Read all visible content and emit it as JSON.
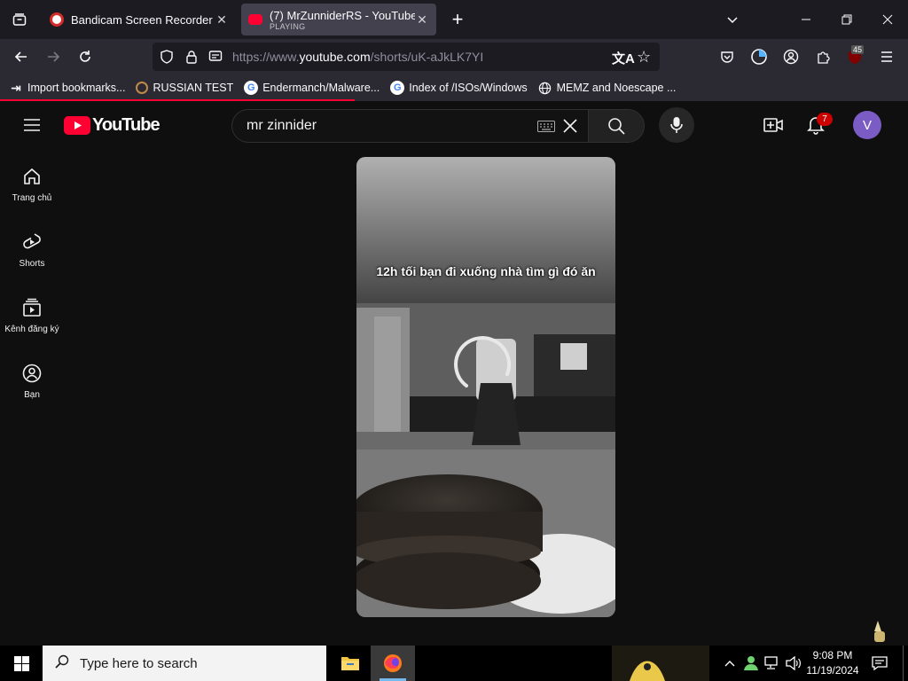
{
  "browser": {
    "tabs": [
      {
        "title": "Bandicam Screen Recorder Dow",
        "favicon": "bandicam-icon"
      },
      {
        "title": "(7) MrZunniderRS - YouTube",
        "status": "PLAYING",
        "favicon": "youtube-icon"
      }
    ],
    "url_prefix": "https://www.",
    "url_host": "youtube.com",
    "url_path": "/shorts/uK-aJkLK7YI",
    "extension_badge": "45",
    "bookmarks": [
      {
        "label": "Import bookmarks...",
        "icon": "import-icon"
      },
      {
        "label": "RUSSIAN TEST",
        "icon": "site-icon"
      },
      {
        "label": "Endermanch/Malware...",
        "icon": "google-icon"
      },
      {
        "label": "Index of /ISOs/Windows",
        "icon": "google-icon"
      },
      {
        "label": "MEMZ and Noescape ...",
        "icon": "globe-icon"
      }
    ]
  },
  "youtube": {
    "logo_text": "YouTube",
    "search_value": "mr zinnider",
    "notification_count": "7",
    "avatar_letter": "V",
    "sidebar": [
      {
        "label": "Trang chủ",
        "icon": "home-icon"
      },
      {
        "label": "Shorts",
        "icon": "shorts-icon"
      },
      {
        "label": "Kênh đăng ký",
        "icon": "subscriptions-icon"
      },
      {
        "label": "Bạn",
        "icon": "you-icon"
      }
    ],
    "video_caption": "12h tối bạn đi xuống nhà tìm gì đó ăn"
  },
  "taskbar": {
    "search_placeholder": "Type here to search",
    "time": "9:08 PM",
    "date": "11/19/2024"
  },
  "colors": {
    "youtube_red": "#ff0033",
    "avatar_purple": "#7b5cc4",
    "firefox_tab_bg": "#42414d"
  }
}
